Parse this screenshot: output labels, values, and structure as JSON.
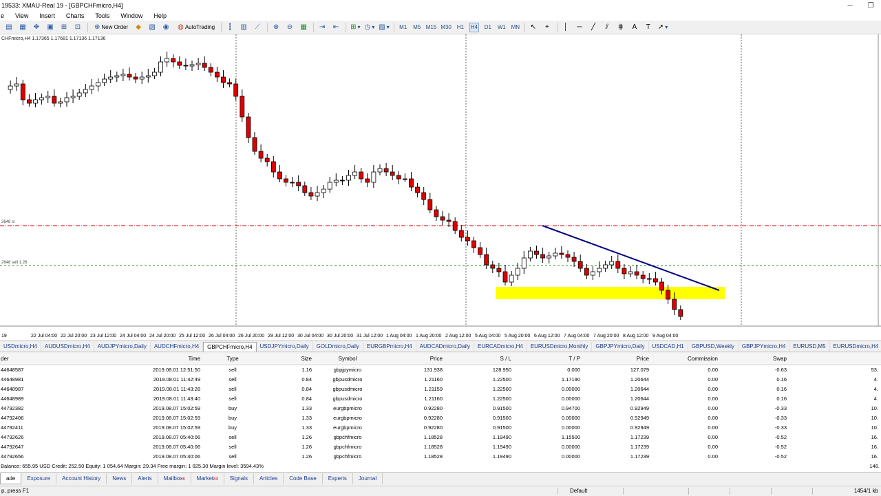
{
  "window": {
    "title": "19533: XMAU-Real 19 - [GBPCHFmicro,H4]",
    "controls": [
      "─",
      "❐"
    ]
  },
  "menu": [
    "e",
    "View",
    "Insert",
    "Charts",
    "Tools",
    "Window",
    "Help"
  ],
  "toolbar": {
    "new_order": "New Order",
    "autotrading": "AutoTrading",
    "timeframes": [
      "M1",
      "M5",
      "M15",
      "M30",
      "H1",
      "H4",
      "D1",
      "W1",
      "MN"
    ],
    "active_timeframe": "H4"
  },
  "chart": {
    "ohlc_text": "CHFmicro,H4  1.17365 1.17681 1.17136 1.17136",
    "order_labels": [
      "2648 sl",
      "2648 sell 1.26"
    ],
    "time_labels": [
      "19",
      "22 Jul 04:00",
      "22 Jul 20:00",
      "23 Jul 12:00",
      "24 Jul 04:00",
      "24 Jul 20:00",
      "25 Jul 12:00",
      "26 Jul 04:00",
      "26 Jul 20:00",
      "29 Jul 12:00",
      "30 Jul 04:00",
      "30 Jul 20:00",
      "31 Jul 12:00",
      "1 Aug 04:00",
      "1 Aug 20:00",
      "2 Aug 12:00",
      "5 Aug 04:00",
      "5 Aug 20:00",
      "6 Aug 12:00",
      "7 Aug 04:00",
      "7 Aug 20:00",
      "8 Aug 12:00",
      "9 Aug 04:00"
    ],
    "colors": {
      "bull": "#ffffff",
      "bear": "#e00000",
      "outline": "#000000",
      "sl_line": "#d00000",
      "order_line": "#1a9a1a",
      "trendline": "#000080",
      "zone": "#ffff00"
    }
  },
  "chart_tabs": [
    "USDmicro,H4",
    "AUDUSDmicro,H4",
    "AUDJPYmicro,Daily",
    "AUDCHFmicro,H4",
    "GBPCHFmicro,H4",
    "USDJPYmicro,Daily",
    "GOLDmicro,Daily",
    "EURGBPmicro,H4",
    "AUDCADmicro,Daily",
    "EURCADmicro,H4",
    "EURUSDmicro,Monthly",
    "GBPJPYmicro,Daily",
    "USDCAD,H1",
    "GBPUSD,Weekly",
    "GBPJPYmicro,H4",
    "EURUSD,M5",
    "EURUSDmicro,H4"
  ],
  "active_chart_tab": "GBPCHFmicro,H4",
  "terminal": {
    "headers": [
      "der",
      "Time",
      "Type",
      "Size",
      "Symbol",
      "Price",
      "S / L",
      "T / P",
      "Price",
      "Commission",
      "Swap",
      ""
    ],
    "rows": [
      [
        "44648587",
        "2019.08.01 12:51:50",
        "sell",
        "1.16",
        "gbpjpymicro",
        "131.938",
        "128.950",
        "0.000",
        "127.079",
        "0.00",
        "-0.63",
        "53."
      ],
      [
        "44648981",
        "2019.08.01 11:42:49",
        "sell",
        "0.84",
        "gbpusdmicro",
        "1.21160",
        "1.22500",
        "1.17190",
        "1.20644",
        "0.00",
        "0.16",
        "4."
      ],
      [
        "44648987",
        "2019.08.01 11:43:28",
        "sell",
        "0.84",
        "gbpusdmicro",
        "1.21159",
        "1.22500",
        "0.00000",
        "1.20644",
        "0.00",
        "0.16",
        "4."
      ],
      [
        "44648989",
        "2019.08.01 11:43:40",
        "sell",
        "0.84",
        "gbpusdmicro",
        "1.21160",
        "1.22500",
        "0.00000",
        "1.20644",
        "0.00",
        "0.16",
        "4."
      ],
      [
        "44792382",
        "2019.08.07 15:02:59",
        "buy",
        "1.33",
        "eurgbpmicro",
        "0.92280",
        "0.91500",
        "0.94700",
        "0.92949",
        "0.00",
        "-0.33",
        "10."
      ],
      [
        "44792406",
        "2019.08.07 15:02:59",
        "buy",
        "1.33",
        "eurgbpmicro",
        "0.92280",
        "0.91500",
        "0.00000",
        "0.92949",
        "0.00",
        "-0.33",
        "10."
      ],
      [
        "44792411",
        "2019.08.07 15:02:59",
        "buy",
        "1.33",
        "eurgbpmicro",
        "0.92280",
        "0.91500",
        "0.00000",
        "0.92949",
        "0.00",
        "-0.33",
        "10."
      ],
      [
        "44792626",
        "2019.08.07 05:40:06",
        "sell",
        "1.26",
        "gbpchfmicro",
        "1.18528",
        "1.19490",
        "1.15500",
        "1.17239",
        "0.00",
        "-0.52",
        "16."
      ],
      [
        "44792647",
        "2019.08.07 05:40:06",
        "sell",
        "1.26",
        "gbpchfmicro",
        "1.18528",
        "1.19490",
        "0.00000",
        "1.17239",
        "0.00",
        "-0.52",
        "16."
      ],
      [
        "44792656",
        "2019.08.07 05:40:06",
        "sell",
        "1.26",
        "gbpchfmicro",
        "1.18528",
        "1.19490",
        "0.00000",
        "1.17239",
        "0.00",
        "-0.52",
        "16."
      ]
    ],
    "balance_line": "Balance: 655.95 USD  Credit: 252.50  Equity: 1 054.64  Margin: 29.34  Free margin: 1 025.30  Margin level: 3594.43%",
    "total": "146.",
    "tabs": [
      {
        "label": "ade",
        "badge": ""
      },
      {
        "label": "Exposure",
        "badge": ""
      },
      {
        "label": "Account History",
        "badge": ""
      },
      {
        "label": "News",
        "badge": ""
      },
      {
        "label": "Alerts",
        "badge": ""
      },
      {
        "label": "Mailbox",
        "badge": "6"
      },
      {
        "label": "Market",
        "badge": "83"
      },
      {
        "label": "Signals",
        "badge": ""
      },
      {
        "label": "Articles",
        "badge": ""
      },
      {
        "label": "Code Base",
        "badge": ""
      },
      {
        "label": "Experts",
        "badge": ""
      },
      {
        "label": "Journal",
        "badge": ""
      }
    ]
  },
  "status": {
    "help": "p, press F1",
    "profile": "Default",
    "traffic": "1454/1 kb"
  }
}
